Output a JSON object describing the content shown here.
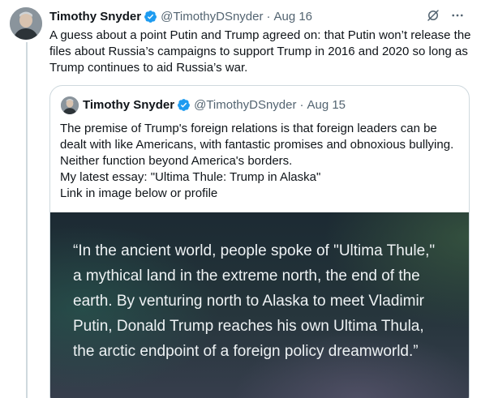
{
  "tweet": {
    "author_name": "Timothy Snyder",
    "handle": "@TimothyDSnyder",
    "separator": "·",
    "date": "Aug 16",
    "text": "A guess about a point Putin and Trump agreed on: that Putin won’t release the files about Russia’s campaigns to support Trump in 2016 and 2020 so long as Trump continues to aid Russia’s war."
  },
  "quoted_tweet": {
    "author_name": "Timothy Snyder",
    "handle": "@TimothyDSnyder",
    "separator": "·",
    "date": "Aug 15",
    "text_lines": [
      "The premise of Trump's foreign relations is that foreign leaders can be dealt with like Americans, with fantastic promises and obnoxious bullying. Neither function beyond America's borders.",
      "My latest essay: \"Ultima Thule: Trump in Alaska\"",
      "Link in image below or profile"
    ],
    "image_quote": "“In the ancient world, people spoke of \"Ultima Thule,\" a mythical land in the extreme north, the end of the earth. By venturing north to Alaska to meet Vladimir Putin, Donald Trump reaches his own Ultima Thula, the arctic endpoint of a foreign policy dreamworld.”"
  },
  "icons": {
    "verified": "verified-badge-icon",
    "grok": "grok-icon",
    "more": "more-icon"
  },
  "colors": {
    "verified_blue": "#1d9bf0",
    "secondary_text": "#536471",
    "border": "#cfd9de"
  }
}
